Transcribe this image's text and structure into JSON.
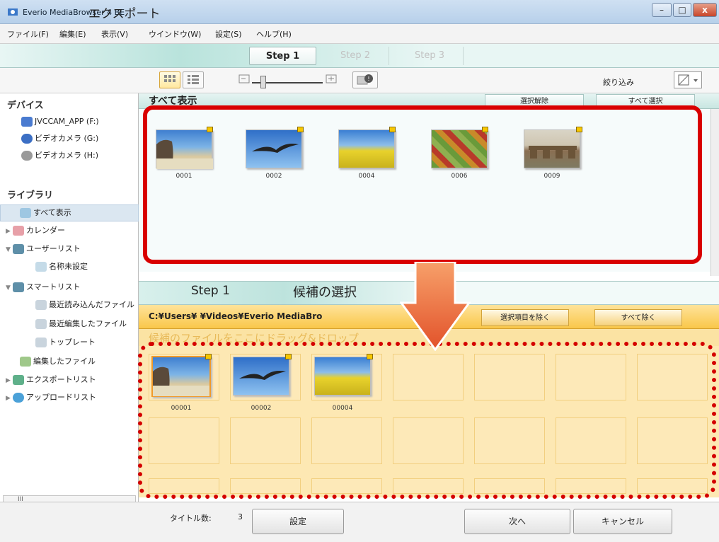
{
  "window": {
    "title": "Everio MediaBrowser 4 BE",
    "minimize": "–",
    "maximize": "□",
    "close": "x"
  },
  "menu": [
    "ファイル(F)",
    "編集(E)",
    "表示(V)",
    "ウインドウ(W)",
    "設定(S)",
    "ヘルプ(H)"
  ],
  "header": {
    "title": "エクスポート",
    "steps": [
      "Step 1",
      "Step 2",
      "Step 3"
    ]
  },
  "toolbar": {
    "filter_label": "絞り込み"
  },
  "sidebar": {
    "devices_title": "デバイス",
    "devices": [
      "JVCCAM_APP (F:)",
      "ビデオカメラ (G:)",
      "ビデオカメラ (H:)"
    ],
    "library_title": "ライブラリ",
    "library": [
      {
        "label": "すべて表示",
        "arrow": ""
      },
      {
        "label": "カレンダー",
        "arrow": "▶"
      },
      {
        "label": "ユーザーリスト",
        "arrow": "▼"
      },
      {
        "label": "名称未設定",
        "arrow": ""
      },
      {
        "label": "スマートリスト",
        "arrow": "▼"
      },
      {
        "label": "最近読み込んだファイル",
        "arrow": ""
      },
      {
        "label": "最近編集したファイル",
        "arrow": ""
      },
      {
        "label": "トップレート",
        "arrow": ""
      },
      {
        "label": "編集したファイル",
        "arrow": ""
      },
      {
        "label": "エクスポートリスト",
        "arrow": "▶"
      },
      {
        "label": "アップロードリスト",
        "arrow": "▶"
      }
    ],
    "scroll_label": "III"
  },
  "all_view": {
    "title": "すべて表示",
    "deselect": "選択解除",
    "select_all": "すべて選択",
    "thumbnails": [
      "0001",
      "0002",
      "0004",
      "0006",
      "0009"
    ]
  },
  "step_section": {
    "step_label": "Step 1",
    "title": "候補の選択",
    "path": "C:¥Users¥        ¥Videos¥Everio MediaBro",
    "remove_selected": "選択項目を除く",
    "remove_all": "すべて除く",
    "hint": "候補のファイルをここにドラッグ&ドロップ",
    "candidates": [
      "00001",
      "00002",
      "00004"
    ]
  },
  "bottom": {
    "title_count_label": "タイトル数:",
    "title_count": "3",
    "settings": "設定",
    "next": "次へ",
    "cancel": "キャンセル"
  }
}
